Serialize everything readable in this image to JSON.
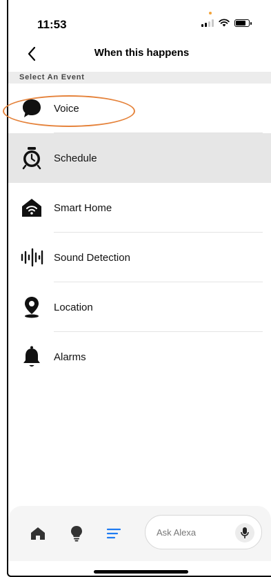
{
  "status_bar": {
    "time": "11:53"
  },
  "header": {
    "title": "When this happens"
  },
  "section": {
    "label": "Select An Event"
  },
  "events": [
    {
      "label": "Voice",
      "icon": "speech-bubble-icon"
    },
    {
      "label": "Schedule",
      "icon": "alarm-clock-icon"
    },
    {
      "label": "Smart Home",
      "icon": "smart-home-icon"
    },
    {
      "label": "Sound Detection",
      "icon": "sound-wave-icon"
    },
    {
      "label": "Location",
      "icon": "location-pin-icon"
    },
    {
      "label": "Alarms",
      "icon": "bell-icon"
    }
  ],
  "bottom_nav": {
    "items": [
      {
        "icon": "home-icon"
      },
      {
        "icon": "lightbulb-icon"
      },
      {
        "icon": "more-list-icon"
      }
    ],
    "ask_alexa_placeholder": "Ask Alexa",
    "mic_icon": "microphone-icon"
  },
  "colors": {
    "highlight_row": "#e6e6e6",
    "annotation_circle": "#e5823a",
    "active_nav": "#1e7bf2"
  }
}
